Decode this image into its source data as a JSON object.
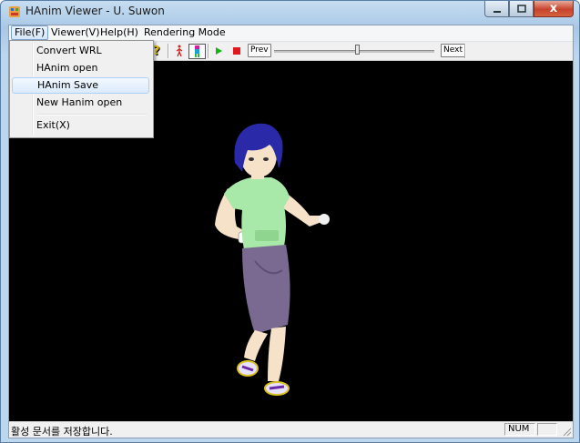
{
  "window": {
    "title": "HAnim Viewer - U. Suwon",
    "close_glyph": "x"
  },
  "menubar": {
    "items": [
      {
        "label": "File(F)"
      },
      {
        "label": "Viewer(V)"
      },
      {
        "label": "Help(H)"
      },
      {
        "label": "Rendering Mode"
      }
    ]
  },
  "file_menu": {
    "items": [
      {
        "label": "Convert WRL"
      },
      {
        "label": "HAnim open"
      },
      {
        "label": "HAnim Save"
      },
      {
        "label": "New Hanim open"
      },
      {
        "label": "Exit(X)"
      }
    ]
  },
  "toolbar": {
    "prev_label": "Prev",
    "next_label": "Next"
  },
  "status": {
    "message": "활성 문서를 저장합니다.",
    "num": "NUM"
  },
  "colors": {
    "viewport_bg": "#000000",
    "hair": "#2a2aa8",
    "shirt": "#a8e8a8",
    "skirt": "#7a6a92",
    "skin": "#f6e2c8",
    "play": "#12b312",
    "stop": "#e01818"
  }
}
